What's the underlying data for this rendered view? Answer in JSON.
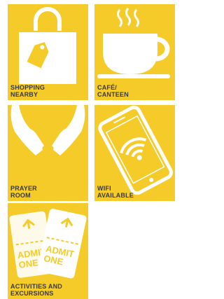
{
  "tiles": [
    {
      "id": "shopping",
      "icon": "shopping-bag-icon",
      "line1": "SHOPPING",
      "line2": "NEARBY"
    },
    {
      "id": "cafe",
      "icon": "coffee-cup-icon",
      "line1": "CAFÉ/",
      "line2": "CANTEEN"
    },
    {
      "id": "prayer",
      "icon": "open-hands-icon",
      "line1": "PRAYER",
      "line2": "ROOM"
    },
    {
      "id": "wifi",
      "icon": "smartphone-wifi-icon",
      "line1": "WIFI",
      "line2": "AVAILABLE"
    },
    {
      "id": "activities",
      "icon": "admit-one-tickets-icon",
      "line1": "ACTIVITIES AND",
      "line2": "EXCURSIONS",
      "ticket_text": [
        "ADMIT",
        "ONE"
      ]
    }
  ],
  "colors": {
    "tile": "#f4cb28",
    "icon": "#ffffff",
    "text": "#3a3a3a"
  }
}
